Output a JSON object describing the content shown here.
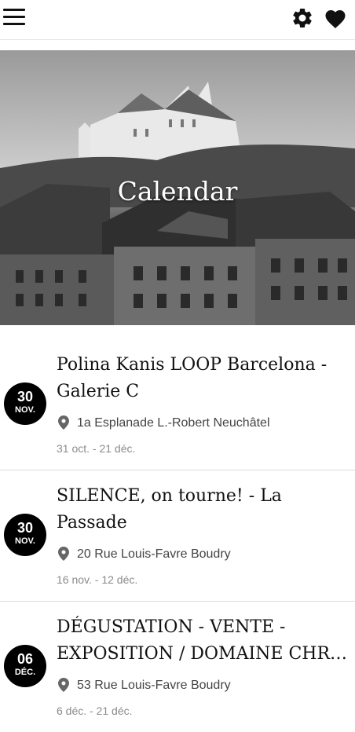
{
  "header": {
    "icons": [
      "menu-icon",
      "gear-icon",
      "heart-icon"
    ]
  },
  "hero": {
    "title": "Calendar"
  },
  "events": [
    {
      "day": "30",
      "month": "NOV.",
      "title_line1": "Polina Kanis  LOOP Barcelona -",
      "title_line2": "Galerie C",
      "address": "1a Esplanade L.-Robert Neuchâtel",
      "dates": "31 oct. - 21 déc."
    },
    {
      "day": "30",
      "month": "NOV.",
      "title_line1": "SILENCE, on tourne! - La",
      "title_line2": "Passade",
      "address": "20 Rue Louis-Favre Boudry",
      "dates": "16 nov. - 12 déc."
    },
    {
      "day": "06",
      "month": "DÉC.",
      "title_line1": "DÉGUSTATION - VENTE -",
      "title_line2": "EXPOSITION / DOMAINE CHRI...",
      "address": "53 Rue Louis-Favre Boudry",
      "dates": "6 déc. - 21 déc."
    }
  ],
  "colors": {
    "badge": "#000000",
    "text": "#111111",
    "muted": "#8a8a8a"
  }
}
